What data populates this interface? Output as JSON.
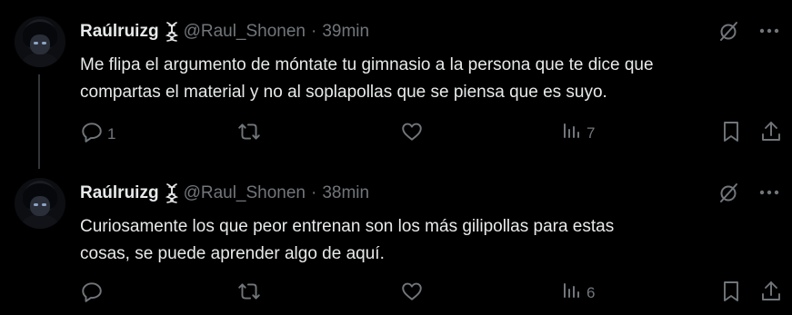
{
  "colors": {
    "background": "#000000",
    "text": "#e7e9ea",
    "muted": "#71767b",
    "thread_line": "#333639"
  },
  "tweets": [
    {
      "name": "Raúlruizg",
      "handle": "@Raul_Shonen",
      "separator": "·",
      "time": "39min",
      "lines": [
        "Me flipa el argumento de móntate tu gimnasio a la persona que te dice que",
        "compartas el material y no al soplapollas que se piensa que es suyo."
      ],
      "reply_count": "1",
      "retweet_count": "",
      "like_count": "",
      "view_count": "7",
      "icons": [
        "reply-icon",
        "retweet-icon",
        "like-icon",
        "views-icon",
        "bookmark-icon",
        "share-icon",
        "grok-icon",
        "more-icon"
      ]
    },
    {
      "name": "Raúlruizg",
      "handle": "@Raul_Shonen",
      "separator": "·",
      "time": "38min",
      "lines": [
        "Curiosamente los que peor entrenan son los más gilipollas para estas",
        "cosas, se puede aprender algo de aquí."
      ],
      "reply_count": "",
      "retweet_count": "",
      "like_count": "",
      "view_count": "6",
      "icons": [
        "reply-icon",
        "retweet-icon",
        "like-icon",
        "views-icon",
        "bookmark-icon",
        "share-icon",
        "grok-icon",
        "more-icon"
      ]
    }
  ]
}
